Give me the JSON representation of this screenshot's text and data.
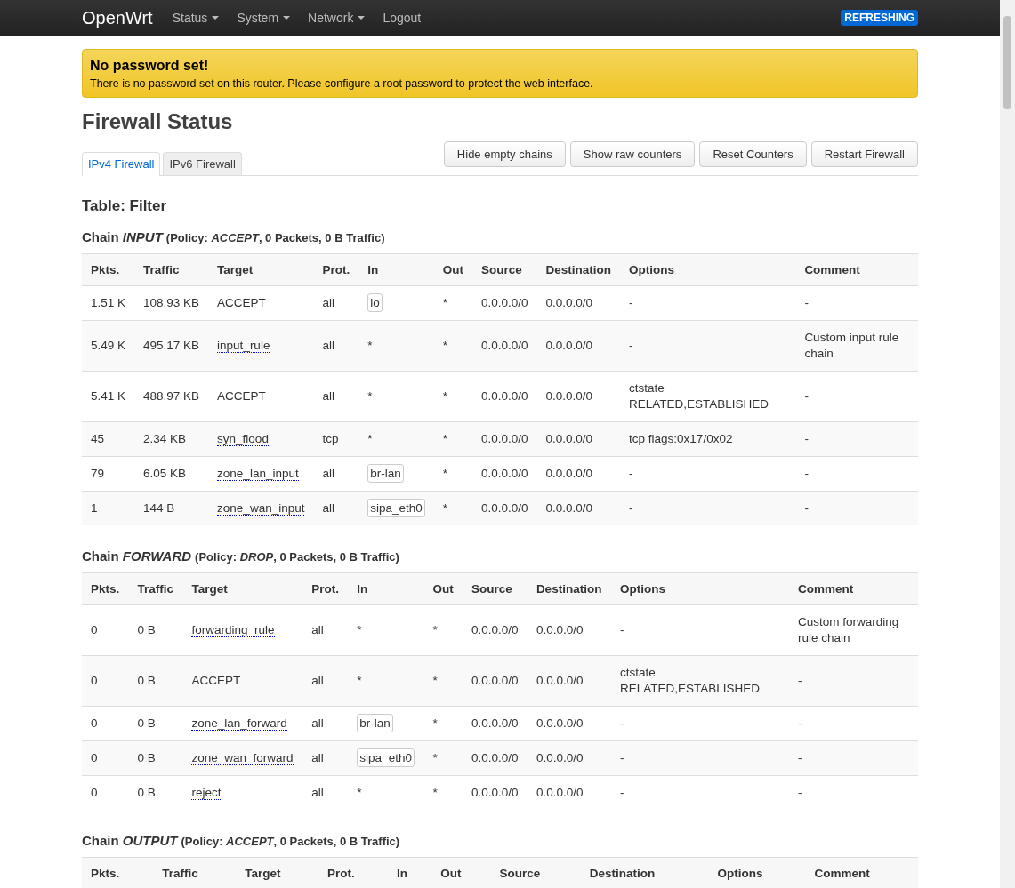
{
  "navbar": {
    "brand": "OpenWrt",
    "menus": [
      {
        "label": "Status",
        "dropdown": true
      },
      {
        "label": "System",
        "dropdown": true
      },
      {
        "label": "Network",
        "dropdown": true
      },
      {
        "label": "Logout",
        "dropdown": false
      }
    ],
    "indicator": "REFRESHING"
  },
  "alert": {
    "title": "No password set!",
    "text": "There is no password set on this router. Please configure a root password to protect the web interface."
  },
  "page_title": "Firewall Status",
  "tabs": [
    {
      "label": "IPv4 Firewall",
      "selected": true
    },
    {
      "label": "IPv6 Firewall",
      "selected": false
    }
  ],
  "buttons": [
    "Hide empty chains",
    "Show raw counters",
    "Reset Counters",
    "Restart Firewall"
  ],
  "table_title": "Table: Filter",
  "chains": [
    {
      "title": "Chain *INPUT*",
      "policy": "(Policy: *ACCEPT*, 0 Packets, 0 B Traffic)",
      "columns": [
        "Pkts.",
        "Traffic",
        "Target",
        "Prot.",
        "In",
        "Out",
        "Source",
        "Destination",
        "Options",
        "Comment"
      ],
      "rows": [
        {
          "pkts": "1.51 K",
          "traffic": "108.93 KB",
          "target": "ACCEPT",
          "target_is_chain": false,
          "prot": "all",
          "in": "lo",
          "in_is_interface": true,
          "out": "*",
          "source": "0.0.0.0/0",
          "destination": "0.0.0.0/0",
          "options": "-",
          "comment": "-"
        },
        {
          "pkts": "5.49 K",
          "traffic": "495.17 KB",
          "target": "input_rule",
          "target_is_chain": true,
          "prot": "all",
          "in": "*",
          "in_is_interface": false,
          "out": "*",
          "source": "0.0.0.0/0",
          "destination": "0.0.0.0/0",
          "options": "-",
          "comment": "Custom input rule chain"
        },
        {
          "pkts": "5.41 K",
          "traffic": "488.97 KB",
          "target": "ACCEPT",
          "target_is_chain": false,
          "prot": "all",
          "in": "*",
          "in_is_interface": false,
          "out": "*",
          "source": "0.0.0.0/0",
          "destination": "0.0.0.0/0",
          "options": "ctstate RELATED,ESTABLISHED",
          "comment": "-"
        },
        {
          "pkts": "45",
          "traffic": "2.34 KB",
          "target": "syn_flood",
          "target_is_chain": true,
          "prot": "tcp",
          "in": "*",
          "in_is_interface": false,
          "out": "*",
          "source": "0.0.0.0/0",
          "destination": "0.0.0.0/0",
          "options": "tcp flags:0x17/0x02",
          "comment": "-"
        },
        {
          "pkts": "79",
          "traffic": "6.05 KB",
          "target": "zone_lan_input",
          "target_is_chain": true,
          "prot": "all",
          "in": "br-lan",
          "in_is_interface": true,
          "out": "*",
          "source": "0.0.0.0/0",
          "destination": "0.0.0.0/0",
          "options": "-",
          "comment": "-"
        },
        {
          "pkts": "1",
          "traffic": "144 B",
          "target": "zone_wan_input",
          "target_is_chain": true,
          "prot": "all",
          "in": "sipa_eth0",
          "in_is_interface": true,
          "out": "*",
          "source": "0.0.0.0/0",
          "destination": "0.0.0.0/0",
          "options": "-",
          "comment": "-"
        }
      ]
    },
    {
      "title": "Chain *FORWARD*",
      "policy": "(Policy: *DROP*, 0 Packets, 0 B Traffic)",
      "columns": [
        "Pkts.",
        "Traffic",
        "Target",
        "Prot.",
        "In",
        "Out",
        "Source",
        "Destination",
        "Options",
        "Comment"
      ],
      "rows": [
        {
          "pkts": "0",
          "traffic": "0 B",
          "target": "forwarding_rule",
          "target_is_chain": true,
          "prot": "all",
          "in": "*",
          "in_is_interface": false,
          "out": "*",
          "source": "0.0.0.0/0",
          "destination": "0.0.0.0/0",
          "options": "-",
          "comment": "Custom forwarding rule chain"
        },
        {
          "pkts": "0",
          "traffic": "0 B",
          "target": "ACCEPT",
          "target_is_chain": false,
          "prot": "all",
          "in": "*",
          "in_is_interface": false,
          "out": "*",
          "source": "0.0.0.0/0",
          "destination": "0.0.0.0/0",
          "options": "ctstate RELATED,ESTABLISHED",
          "comment": "-"
        },
        {
          "pkts": "0",
          "traffic": "0 B",
          "target": "zone_lan_forward",
          "target_is_chain": true,
          "prot": "all",
          "in": "br-lan",
          "in_is_interface": true,
          "out": "*",
          "source": "0.0.0.0/0",
          "destination": "0.0.0.0/0",
          "options": "-",
          "comment": "-"
        },
        {
          "pkts": "0",
          "traffic": "0 B",
          "target": "zone_wan_forward",
          "target_is_chain": true,
          "prot": "all",
          "in": "sipa_eth0",
          "in_is_interface": true,
          "out": "*",
          "source": "0.0.0.0/0",
          "destination": "0.0.0.0/0",
          "options": "-",
          "comment": "-"
        },
        {
          "pkts": "0",
          "traffic": "0 B",
          "target": "reject",
          "target_is_chain": true,
          "prot": "all",
          "in": "*",
          "in_is_interface": false,
          "out": "*",
          "source": "0.0.0.0/0",
          "destination": "0.0.0.0/0",
          "options": "-",
          "comment": "-"
        }
      ]
    },
    {
      "title": "Chain *OUTPUT*",
      "policy": "(Policy: *ACCEPT*, 0 Packets, 0 B Traffic)",
      "columns": [
        "Pkts.",
        "Traffic",
        "Target",
        "Prot.",
        "In",
        "Out",
        "Source",
        "Destination",
        "Options",
        "Comment"
      ]
    }
  ]
}
